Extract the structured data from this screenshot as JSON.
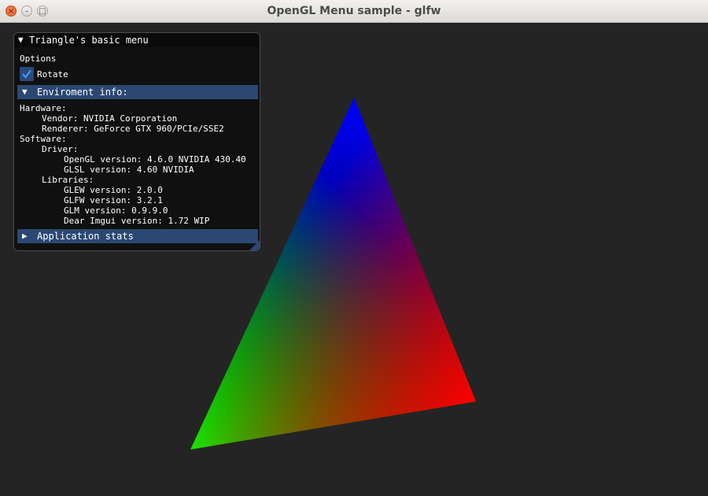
{
  "window": {
    "title": "OpenGL Menu sample - glfw",
    "close_glyph": "×",
    "minimize_glyph": "–",
    "maximize_glyph": "□"
  },
  "menu": {
    "title": "Triangle's basic menu",
    "options_label": "Options",
    "rotate_label": "Rotate",
    "rotate_checked": true,
    "env_header": "Enviroment info:",
    "env": {
      "hardware_label": "Hardware:",
      "vendor": "Vendor: NVIDIA Corporation",
      "renderer": "Renderer: GeForce GTX 960/PCIe/SSE2",
      "software_label": "Software:",
      "driver_label": "Driver:",
      "opengl": "OpenGL version: 4.6.0 NVIDIA 430.40",
      "glsl": "GLSL version: 4.60 NVIDIA",
      "libraries_label": "Libraries:",
      "glew": "GLEW version: 2.0.0",
      "glfw": "GLFW version: 3.2.1",
      "glm": "GLM version: 0.9.9.0",
      "imgui": "Dear Imgui version: 1.72 WIP"
    },
    "stats_header": "Application stats"
  },
  "triangle": {
    "vertex_colors": [
      "#0000ff",
      "#00ff00",
      "#ff0000"
    ]
  },
  "colors": {
    "background": "#242424",
    "header": "#2b4872",
    "checkbox": "#294a7a",
    "checkmark": "#4296fa"
  }
}
